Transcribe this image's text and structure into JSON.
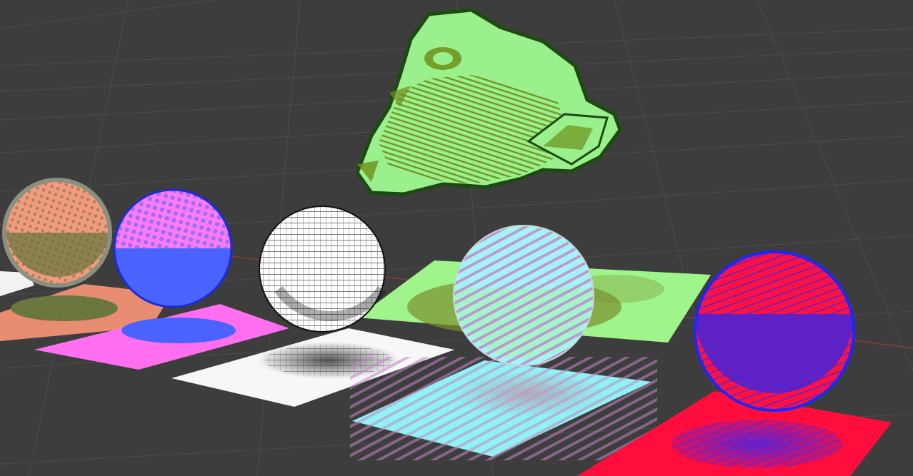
{
  "viewport": {
    "kind": "3d-viewport",
    "background_color": "#3d3d3d",
    "grid_color": "#4a4a4a",
    "x_axis_color": "#8a3a3a"
  },
  "scene": {
    "monkey_head": {
      "fill": "#9af08c",
      "shade": "#6e8f1c",
      "outline": "#1e4a12"
    },
    "spheres": [
      {
        "name": "peach-halftone-sphere",
        "fill": "#f29a7d",
        "shade": "#6d7740",
        "outline": "#8a9080",
        "plane_fill": "#e88c72"
      },
      {
        "name": "magenta-halftone-sphere",
        "fill": "#ff7bf5",
        "shade": "#4a63ff",
        "outline": "#1b2bd8",
        "plane_fill": "#ff6ff0"
      },
      {
        "name": "white-hatched-sphere",
        "fill": "#ffffff",
        "shade": "#1d1d1d",
        "outline": "#101010",
        "plane_fill": "#f7f7f7"
      },
      {
        "name": "cyan-stripe-sphere",
        "fill": "#a4f4f7",
        "shade": "#c385c7",
        "outline": "#c8d8d0",
        "plane_fill": "#8ff3f4"
      },
      {
        "name": "red-stripe-sphere",
        "fill": "#ff1242",
        "shade": "#4625d8",
        "outline": "#1b27ff",
        "plane_fill": "#ff0d3d"
      }
    ],
    "green_plane": {
      "fill": "#9ff58c",
      "shade": "#7a8f2d"
    }
  }
}
